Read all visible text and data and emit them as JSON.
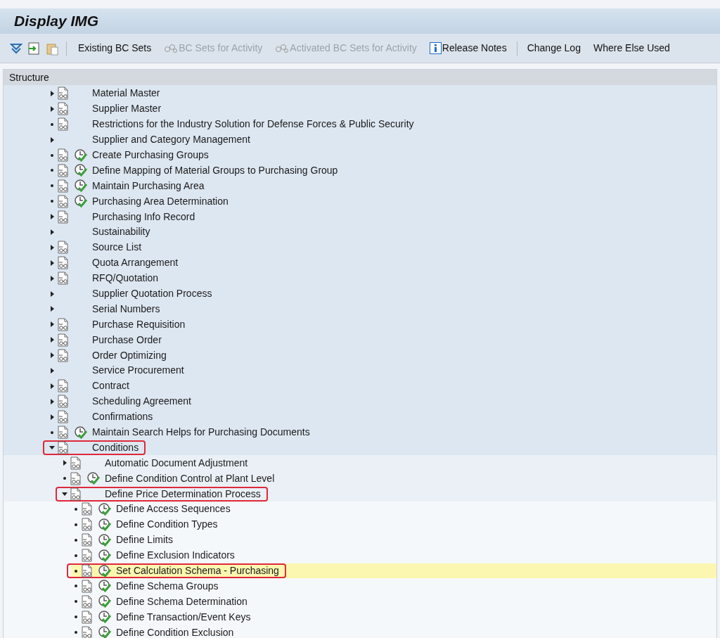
{
  "window": {
    "title": "Display IMG"
  },
  "toolbar": {
    "icon_buttons": [
      {
        "kind": "filter"
      },
      {
        "kind": "export"
      },
      {
        "kind": "clipboard"
      }
    ],
    "buttons": [
      {
        "label": "Existing BC Sets",
        "kind": "plain",
        "disabled": false,
        "separator_before": false
      },
      {
        "label": "BC Sets for Activity",
        "kind": "bcset",
        "disabled": true,
        "separator_before": false
      },
      {
        "label": "Activated BC Sets for Activity",
        "kind": "bcset",
        "disabled": true,
        "separator_before": false
      },
      {
        "label": "Release Notes",
        "kind": "info",
        "disabled": false,
        "separator_before": false
      },
      {
        "label": "Change Log",
        "kind": "plain",
        "disabled": false,
        "separator_before": true
      },
      {
        "label": "Where Else Used",
        "kind": "plain",
        "disabled": false,
        "separator_before": false
      }
    ]
  },
  "structure": {
    "header": "Structure",
    "items": [
      {
        "label": "Material Master",
        "kind": "collapsed",
        "doc": true,
        "activity": false,
        "selected": false,
        "marked": false
      },
      {
        "label": "Supplier Master",
        "kind": "collapsed",
        "doc": true,
        "activity": false,
        "selected": false,
        "marked": false
      },
      {
        "label": "Restrictions for the Industry Solution for Defense Forces & Public Security",
        "kind": "leaf",
        "doc": true,
        "activity": false,
        "selected": false,
        "marked": false
      },
      {
        "label": "Supplier and Category Management",
        "kind": "collapsed",
        "doc": false,
        "activity": false,
        "selected": false,
        "marked": false
      },
      {
        "label": "Create Purchasing Groups",
        "kind": "leaf",
        "doc": true,
        "activity": true,
        "selected": false,
        "marked": false
      },
      {
        "label": "Define Mapping of Material Groups to Purchasing Group",
        "kind": "leaf",
        "doc": true,
        "activity": true,
        "selected": false,
        "marked": false
      },
      {
        "label": "Maintain Purchasing Area",
        "kind": "leaf",
        "doc": true,
        "activity": true,
        "selected": false,
        "marked": false
      },
      {
        "label": "Purchasing Area Determination",
        "kind": "leaf",
        "doc": true,
        "activity": true,
        "selected": false,
        "marked": false
      },
      {
        "label": "Purchasing Info Record",
        "kind": "collapsed",
        "doc": true,
        "activity": false,
        "selected": false,
        "marked": false
      },
      {
        "label": "Sustainability",
        "kind": "collapsed",
        "doc": false,
        "activity": false,
        "selected": false,
        "marked": false
      },
      {
        "label": "Source List",
        "kind": "collapsed",
        "doc": true,
        "activity": false,
        "selected": false,
        "marked": false
      },
      {
        "label": "Quota Arrangement",
        "kind": "collapsed",
        "doc": true,
        "activity": false,
        "selected": false,
        "marked": false
      },
      {
        "label": "RFQ/Quotation",
        "kind": "collapsed",
        "doc": true,
        "activity": false,
        "selected": false,
        "marked": false
      },
      {
        "label": "Supplier Quotation Process",
        "kind": "collapsed",
        "doc": false,
        "activity": false,
        "selected": false,
        "marked": false
      },
      {
        "label": "Serial Numbers",
        "kind": "collapsed",
        "doc": false,
        "activity": false,
        "selected": false,
        "marked": false
      },
      {
        "label": "Purchase Requisition",
        "kind": "collapsed",
        "doc": true,
        "activity": false,
        "selected": false,
        "marked": false
      },
      {
        "label": "Purchase Order",
        "kind": "collapsed",
        "doc": true,
        "activity": false,
        "selected": false,
        "marked": false
      },
      {
        "label": "Order Optimizing",
        "kind": "collapsed",
        "doc": true,
        "activity": false,
        "selected": false,
        "marked": false
      },
      {
        "label": "Service Procurement",
        "kind": "collapsed",
        "doc": false,
        "activity": false,
        "selected": false,
        "marked": false
      },
      {
        "label": "Contract",
        "kind": "collapsed",
        "doc": true,
        "activity": false,
        "selected": false,
        "marked": false
      },
      {
        "label": "Scheduling Agreement",
        "kind": "collapsed",
        "doc": true,
        "activity": false,
        "selected": false,
        "marked": false
      },
      {
        "label": "Confirmations",
        "kind": "collapsed",
        "doc": true,
        "activity": false,
        "selected": false,
        "marked": false
      },
      {
        "label": "Maintain Search Helps for Purchasing Documents",
        "kind": "leaf",
        "doc": true,
        "activity": true,
        "selected": false,
        "marked": false
      },
      {
        "label": "Conditions",
        "kind": "expanded",
        "doc": true,
        "activity": false,
        "selected": false,
        "marked": true,
        "children": [
          {
            "label": "Automatic Document Adjustment",
            "kind": "collapsed",
            "doc": true,
            "activity": false,
            "selected": false,
            "marked": false
          },
          {
            "label": "Define Condition Control at Plant Level",
            "kind": "leaf",
            "doc": true,
            "activity": true,
            "selected": false,
            "marked": false
          },
          {
            "label": "Define Price Determination Process",
            "kind": "expanded",
            "doc": true,
            "activity": false,
            "selected": false,
            "marked": true,
            "children": [
              {
                "label": "Define Access Sequences",
                "kind": "leaf",
                "doc": true,
                "activity": true,
                "selected": false,
                "marked": false
              },
              {
                "label": "Define Condition Types",
                "kind": "leaf",
                "doc": true,
                "activity": true,
                "selected": false,
                "marked": false
              },
              {
                "label": "Define Limits",
                "kind": "leaf",
                "doc": true,
                "activity": true,
                "selected": false,
                "marked": false
              },
              {
                "label": "Define Exclusion Indicators",
                "kind": "leaf",
                "doc": true,
                "activity": true,
                "selected": false,
                "marked": false
              },
              {
                "label": "Set Calculation Schema - Purchasing",
                "kind": "leaf",
                "doc": true,
                "activity": true,
                "selected": true,
                "marked": true
              },
              {
                "label": "Define Schema Groups",
                "kind": "leaf",
                "doc": true,
                "activity": true,
                "selected": false,
                "marked": false
              },
              {
                "label": "Define Schema Determination",
                "kind": "leaf",
                "doc": true,
                "activity": true,
                "selected": false,
                "marked": false
              },
              {
                "label": "Define Transaction/Event Keys",
                "kind": "leaf",
                "doc": true,
                "activity": true,
                "selected": false,
                "marked": false
              },
              {
                "label": "Define Condition Exclusion",
                "kind": "leaf",
                "doc": true,
                "activity": true,
                "selected": false,
                "marked": false
              }
            ]
          }
        ]
      }
    ]
  }
}
